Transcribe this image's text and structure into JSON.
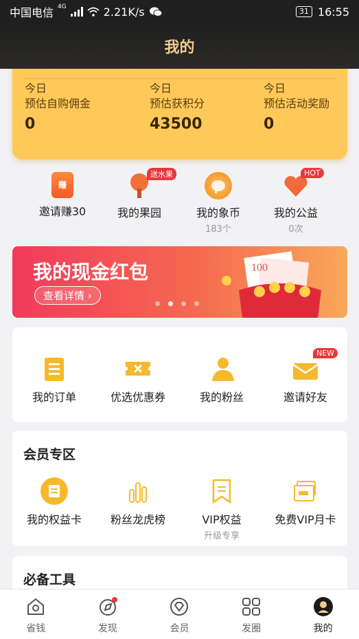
{
  "status_bar": {
    "carrier": "中国电信",
    "network": "4G",
    "speed": "2.21K/s",
    "battery": "31",
    "time": "16:55"
  },
  "header": {
    "title": "我的"
  },
  "earnings": {
    "items": [
      {
        "line1": "今日",
        "line2": "预估自购佣金",
        "value": "0"
      },
      {
        "line1": "今日",
        "line2": "预估获积分",
        "value": "43500"
      },
      {
        "line1": "今日",
        "line2": "预估活动奖励",
        "value": "0"
      }
    ]
  },
  "quick_links": [
    {
      "label": "邀请赚30",
      "icon": "earn-icon",
      "sub": ""
    },
    {
      "label": "我的果园",
      "icon": "fruit-tree-icon",
      "sub": "",
      "tag": "送水果"
    },
    {
      "label": "我的象币",
      "icon": "elephant-coin-icon",
      "sub": "183个"
    },
    {
      "label": "我的公益",
      "icon": "heart-icon",
      "sub": "0次",
      "tag": "HOT"
    }
  ],
  "banner": {
    "title": "我的现金红包",
    "button": "查看详情 ›",
    "money": "100",
    "total_slides": 4,
    "active_slide": 1
  },
  "orders": [
    {
      "label": "我的订单",
      "icon": "order-list-icon"
    },
    {
      "label": "优选优惠券",
      "icon": "coupon-icon"
    },
    {
      "label": "我的粉丝",
      "icon": "fans-icon"
    },
    {
      "label": "邀请好友",
      "icon": "invite-envelope-icon",
      "tag": "NEW"
    }
  ],
  "member": {
    "title": "会员专区",
    "items": [
      {
        "label": "我的权益卡",
        "icon": "benefit-card-icon",
        "sub": ""
      },
      {
        "label": "粉丝龙虎榜",
        "icon": "ranking-bars-icon",
        "sub": ""
      },
      {
        "label": "VIP权益",
        "icon": "vip-bookmark-icon",
        "sub": "升级专享"
      },
      {
        "label": "免费VIP月卡",
        "icon": "vip-card-icon",
        "sub": ""
      }
    ]
  },
  "tools": {
    "title": "必备工具"
  },
  "tabs": [
    {
      "label": "省钱",
      "icon": "home-icon"
    },
    {
      "label": "发现",
      "icon": "compass-icon"
    },
    {
      "label": "会员",
      "icon": "diamond-icon"
    },
    {
      "label": "发圈",
      "icon": "grid-icon"
    },
    {
      "label": "我的",
      "icon": "profile-icon"
    }
  ],
  "colors": {
    "accent": "#ffc95a",
    "banner": "#f23a5b",
    "header_title": "#f0cc8c"
  }
}
